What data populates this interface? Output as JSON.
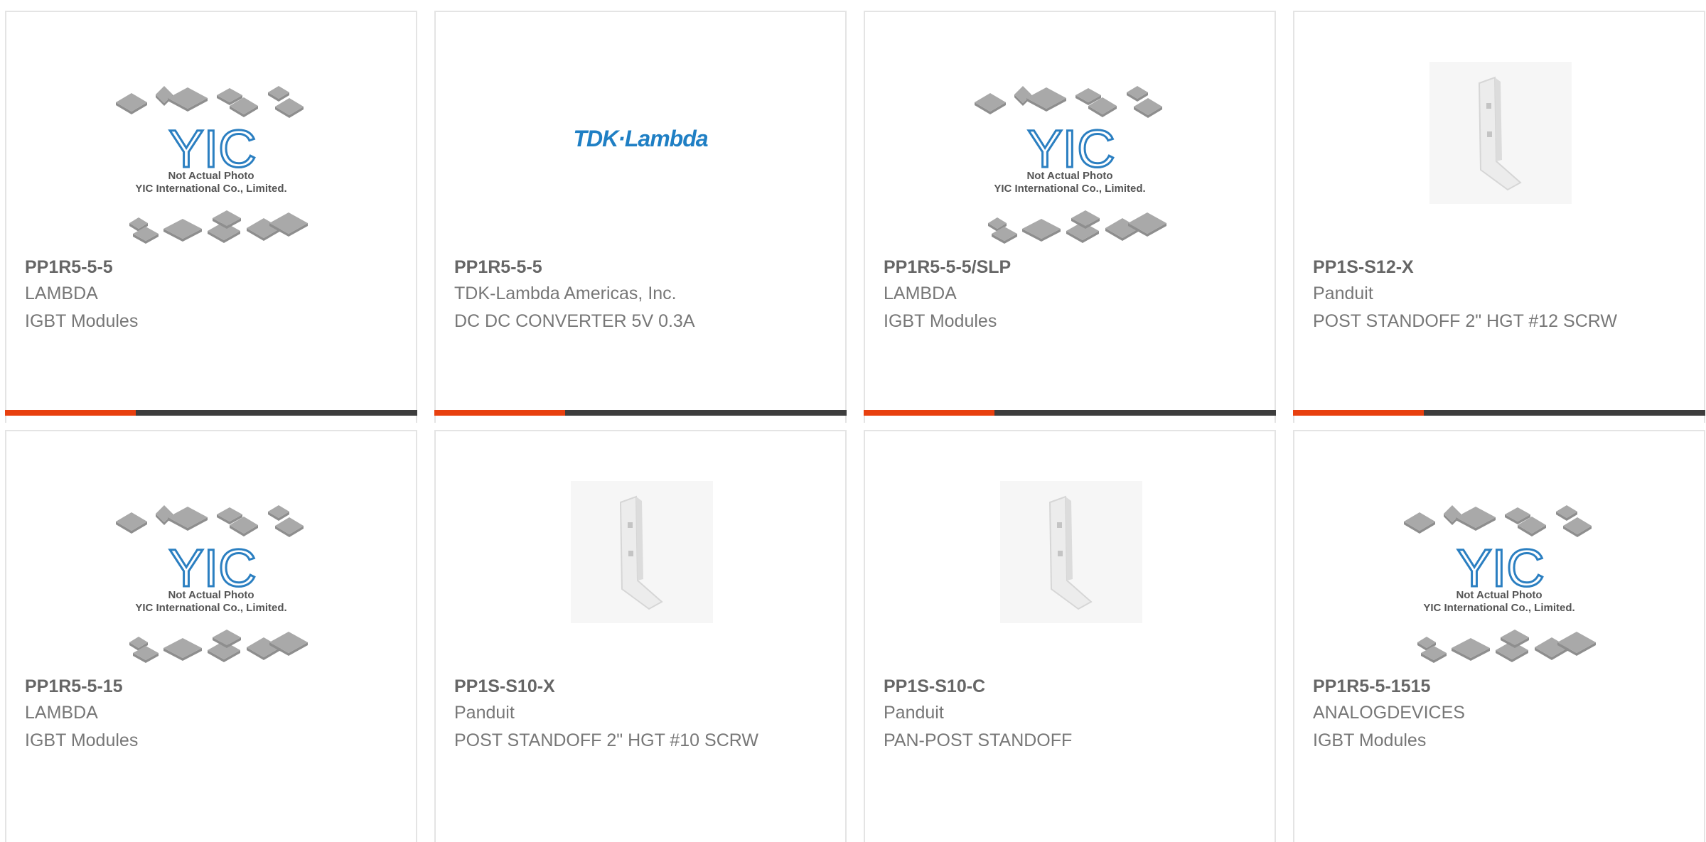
{
  "colors": {
    "accent": "#e8400f",
    "bar": "#3d3d3d",
    "tdk_blue": "#1f7fc4",
    "yic_blue": "#2b7fc1",
    "chip_gray": "#9a9a9a"
  },
  "placeholder": {
    "caption_line1": "Not Actual Photo",
    "caption_line2": "YIC International Co., Limited.",
    "logo_text": "YIC"
  },
  "tdk_logo_text": "TDK·Lambda",
  "products": [
    {
      "part_number": "PP1R5-5-5",
      "manufacturer": "LAMBDA",
      "description": "IGBT Modules",
      "image": "yic-placeholder-icon"
    },
    {
      "part_number": "PP1R5-5-5",
      "manufacturer": "TDK-Lambda Americas, Inc.",
      "description": "DC DC CONVERTER 5V 0.3A",
      "image": "tdk-lambda-logo"
    },
    {
      "part_number": "PP1R5-5-5/SLP",
      "manufacturer": "LAMBDA",
      "description": "IGBT Modules",
      "image": "yic-placeholder-icon"
    },
    {
      "part_number": "PP1S-S12-X",
      "manufacturer": "Panduit",
      "description": "POST STANDOFF 2\" HGT #12 SCRW",
      "image": "standoff-bracket-icon"
    },
    {
      "part_number": "PP1R5-5-15",
      "manufacturer": "LAMBDA",
      "description": "IGBT Modules",
      "image": "yic-placeholder-icon"
    },
    {
      "part_number": "PP1S-S10-X",
      "manufacturer": "Panduit",
      "description": "POST STANDOFF 2\" HGT #10 SCRW",
      "image": "standoff-bracket-icon"
    },
    {
      "part_number": "PP1S-S10-C",
      "manufacturer": "Panduit",
      "description": "PAN-POST STANDOFF",
      "image": "standoff-bracket-icon"
    },
    {
      "part_number": "PP1R5-5-1515",
      "manufacturer": "ANALOGDEVICES",
      "description": "IGBT Modules",
      "image": "yic-placeholder-icon"
    }
  ]
}
